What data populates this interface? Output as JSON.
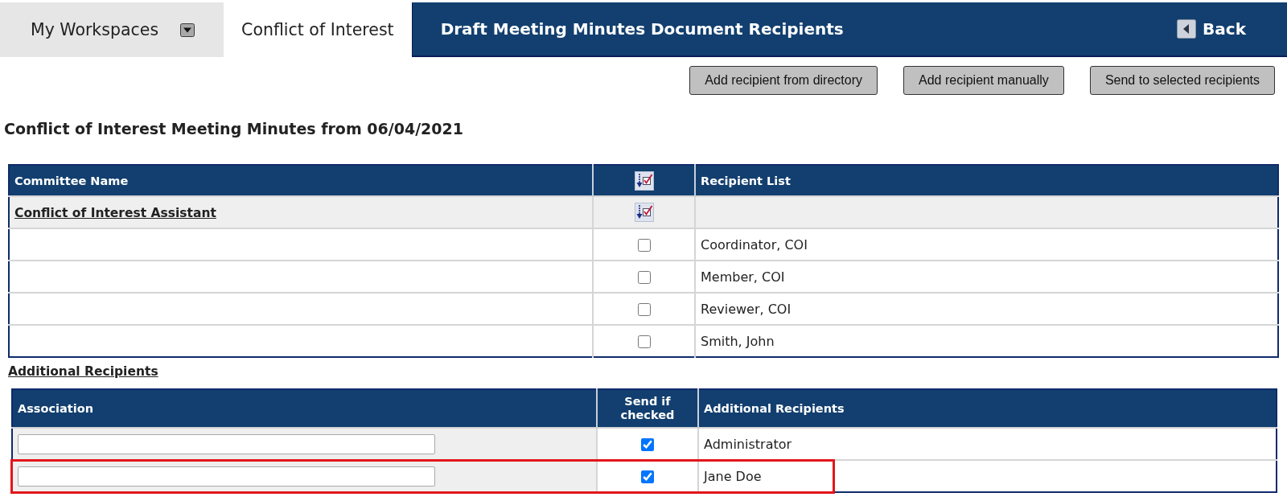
{
  "tabs": [
    {
      "label": "My Workspaces",
      "kind": "dropdown",
      "selected": false
    },
    {
      "label": "Conflict of Interest",
      "kind": "plain",
      "selected": true
    }
  ],
  "title_bar": {
    "title": "Draft Meeting Minutes Document Recipients",
    "back": "Back"
  },
  "actions": [
    "Add recipient from directory",
    "Add recipient manually",
    "Send to selected recipients"
  ],
  "heading": "Conflict of Interest Meeting Minutes from 06/04/2021",
  "committee_table": {
    "columns": [
      {
        "kind": "text",
        "label": "Committee Name"
      },
      {
        "kind": "select_all"
      },
      {
        "kind": "text",
        "label": "Recipient List"
      }
    ],
    "groups": [
      {
        "name": "Conflict of Interest Assistant",
        "recipients": [
          {
            "name": "Coordinator, COI",
            "checked": false
          },
          {
            "name": "Member, COI",
            "checked": false
          },
          {
            "name": "Reviewer, COI",
            "checked": false
          },
          {
            "name": "Smith, John",
            "checked": false
          }
        ]
      }
    ]
  },
  "additional": {
    "title": "Additional Recipients",
    "columns": [
      "Association",
      "Send if checked",
      "Additional Recipients"
    ],
    "rows": [
      {
        "recipient": "Administrator",
        "checked": true,
        "highlighted": false
      },
      {
        "recipient": "Jane Doe",
        "checked": true,
        "highlighted": true
      }
    ]
  }
}
